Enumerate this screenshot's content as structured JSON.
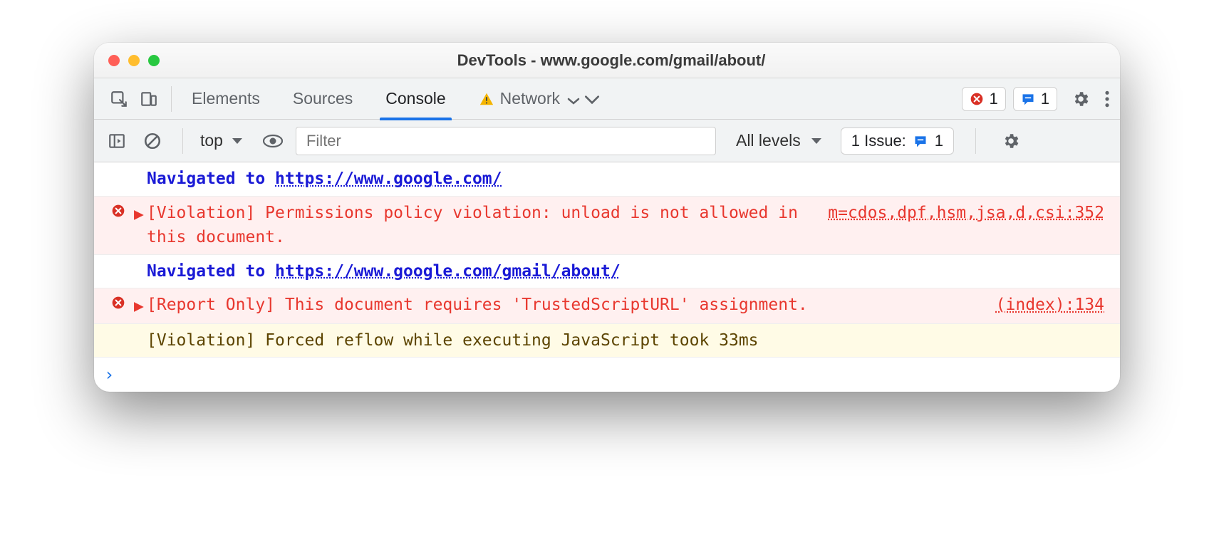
{
  "window": {
    "title": "DevTools - www.google.com/gmail/about/"
  },
  "tabs": {
    "items": [
      "Elements",
      "Sources",
      "Console",
      "Network"
    ],
    "activeIndex": 2,
    "networkHasWarning": true
  },
  "badges": {
    "errors": "1",
    "messages": "1"
  },
  "consoleToolbar": {
    "context": "top",
    "filterPlaceholder": "Filter",
    "levels": "All levels",
    "issuesLabel": "1 Issue:",
    "issuesCount": "1"
  },
  "log": [
    {
      "type": "navigation",
      "prefix": "Navigated to ",
      "url": "https://www.google.com/"
    },
    {
      "type": "error",
      "expandable": true,
      "text": "[Violation] Permissions policy violation: unload is not allowed in this document.",
      "source": "m=cdos,dpf,hsm,jsa,d,csi:352"
    },
    {
      "type": "navigation",
      "prefix": "Navigated to ",
      "url": "https://www.google.com/gmail/about/"
    },
    {
      "type": "error",
      "expandable": true,
      "text": "[Report Only] This document requires 'TrustedScriptURL' assignment.",
      "source": "(index):134"
    },
    {
      "type": "warning",
      "expandable": false,
      "text": "[Violation] Forced reflow while executing JavaScript took 33ms"
    }
  ],
  "prompt": "›"
}
